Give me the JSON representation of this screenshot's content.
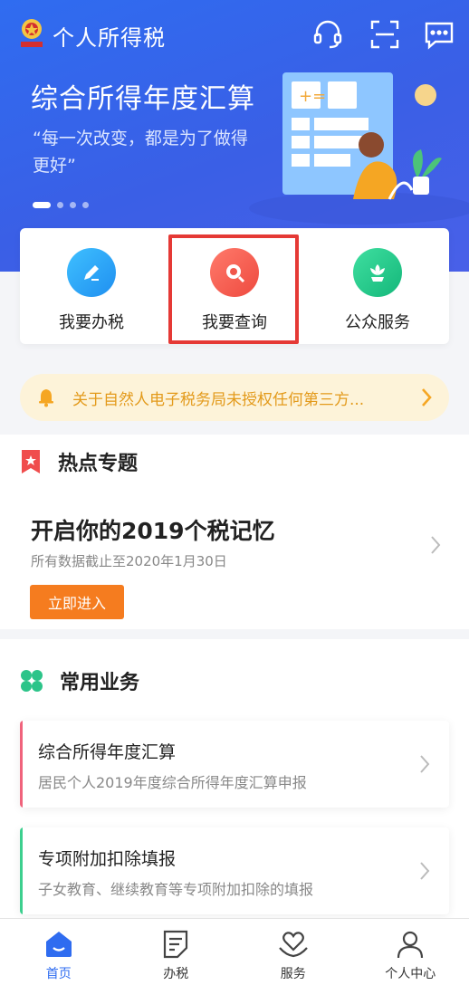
{
  "header": {
    "app_title": "个人所得税",
    "icons": [
      "customer-service-icon",
      "scan-icon",
      "message-icon"
    ]
  },
  "banner": {
    "title": "综合所得年度汇算",
    "subtitle": "“每一次改变，都是为了做得更好”",
    "dots": 4,
    "active_dot": 0
  },
  "quick_actions": [
    {
      "label": "我要办税",
      "icon": "pencil-icon",
      "color": "#29a3f5"
    },
    {
      "label": "我要查询",
      "icon": "search-icon",
      "color": "#f0564a"
    },
    {
      "label": "公众服务",
      "icon": "flower-icon",
      "color": "#21c487"
    }
  ],
  "notice": {
    "text": "关于自然人电子税务局未授权任何第三方...",
    "icon": "bell-icon"
  },
  "hot_topics": {
    "section_title": "热点专题",
    "title": "开启你的2019个税记忆",
    "subtitle": "所有数据截止至2020年1月30日",
    "button": "立即进入"
  },
  "common_business": {
    "section_title": "常用业务",
    "items": [
      {
        "title": "综合所得年度汇算",
        "desc": "居民个人2019年度综合所得年度汇算申报",
        "accent": "#f0637c"
      },
      {
        "title": "专项附加扣除填报",
        "desc": "子女教育、继续教育等专项附加扣除的填报",
        "accent": "#3ccf8e"
      }
    ]
  },
  "bottom_nav": [
    {
      "label": "首页",
      "icon": "home-icon",
      "active": true
    },
    {
      "label": "办税",
      "icon": "document-icon",
      "active": false
    },
    {
      "label": "服务",
      "icon": "heart-hand-icon",
      "active": false
    },
    {
      "label": "个人中心",
      "icon": "user-icon",
      "active": false
    }
  ],
  "colors": {
    "brand_blue": "#2f6cf0",
    "orange": "#f57c1f",
    "notice_bg": "#fdf3d9",
    "notice_text": "#e39a1b",
    "highlight": "#e53935"
  }
}
